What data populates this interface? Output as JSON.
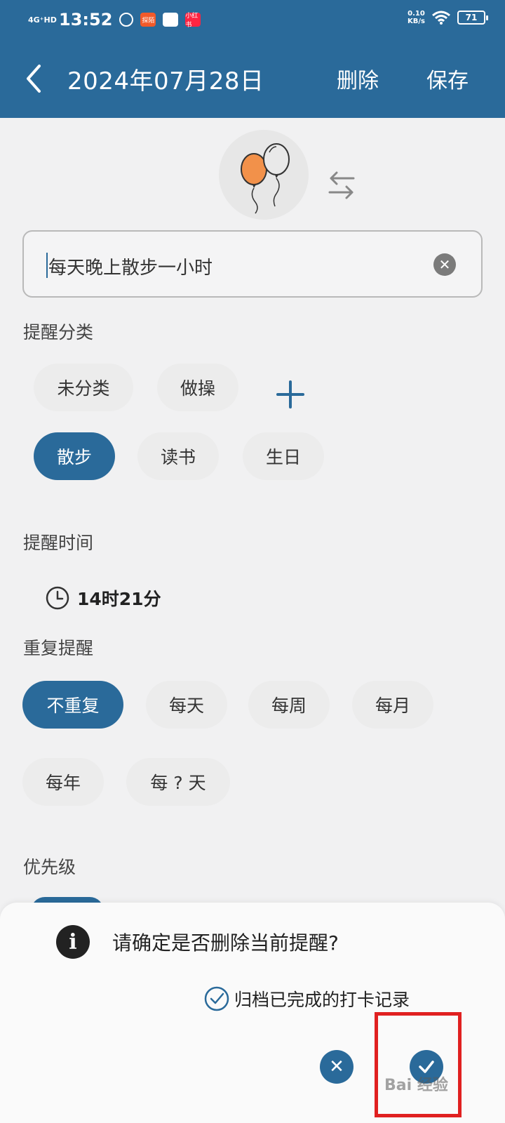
{
  "status_bar": {
    "network": "4G⁺HD",
    "time": "13:52",
    "apps": [
      {
        "label": "",
        "color": "#ffffff",
        "name": "status-app-1"
      },
      {
        "label": "探陌",
        "color": "#f25a2a",
        "name": "status-app-2"
      },
      {
        "label": "",
        "color": "#ffffff",
        "name": "status-app-3"
      },
      {
        "label": "小红书",
        "color": "#ff2442",
        "name": "status-app-4"
      }
    ],
    "speed_value": "0.10",
    "speed_unit": "KB/s",
    "battery": "71"
  },
  "header": {
    "title": "2024年07月28日",
    "delete_label": "删除",
    "save_label": "保存",
    "bg_color": "#2a6a9a"
  },
  "reminder": {
    "icon": "balloons-icon",
    "title_value": "每天晚上散步一小时"
  },
  "category": {
    "label": "提醒分类",
    "chips": [
      "未分类",
      "做操",
      "散步",
      "读书",
      "生日"
    ],
    "selected": "散步"
  },
  "time": {
    "label": "提醒时间",
    "value": "14时21分"
  },
  "repeat": {
    "label": "重复提醒",
    "chips": [
      "不重复",
      "每天",
      "每周",
      "每月",
      "每年",
      "每 ? 天"
    ],
    "selected": "不重复"
  },
  "priority": {
    "label": "优先级"
  },
  "dialog": {
    "message": "请确定是否删除当前提醒?",
    "archive_label": "归档已完成的打卡记录",
    "archive_checked": true
  },
  "watermark": "Bai 经验"
}
